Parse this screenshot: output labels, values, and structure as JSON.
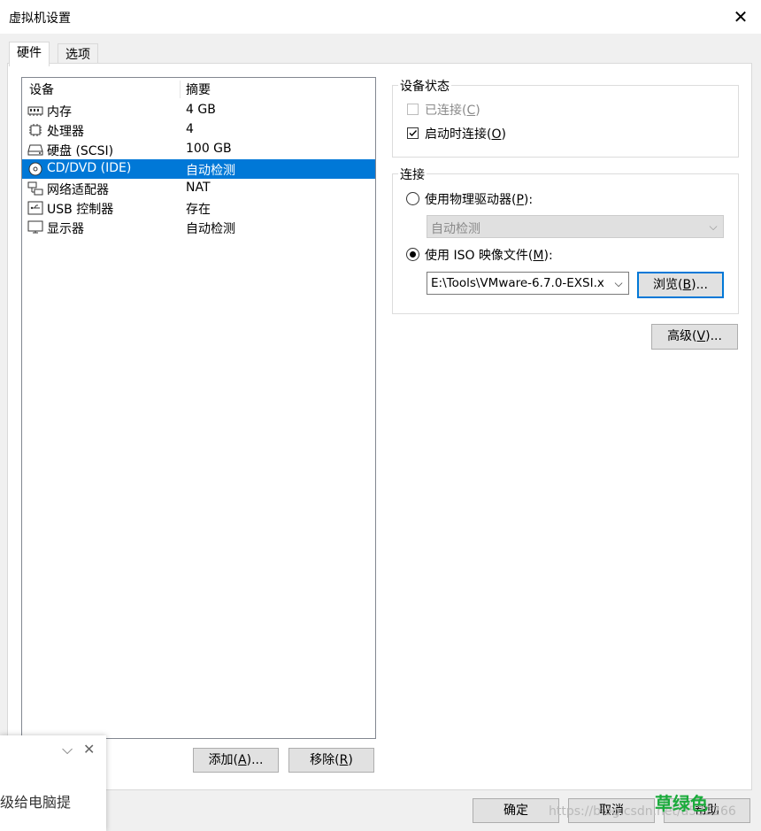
{
  "window": {
    "title": "虚拟机设置",
    "close_glyph": "✕"
  },
  "tabs": [
    {
      "label": "硬件"
    },
    {
      "label": "选项"
    }
  ],
  "device_list": {
    "col_device": "设备",
    "col_summary": "摘要",
    "rows": [
      {
        "name": "内存",
        "summary": "4 GB",
        "icon": "memory-icon"
      },
      {
        "name": "处理器",
        "summary": "4",
        "icon": "cpu-icon"
      },
      {
        "name": "硬盘 (SCSI)",
        "summary": "100 GB",
        "icon": "hard-disk-icon"
      },
      {
        "name": "CD/DVD (IDE)",
        "summary": "自动检测",
        "icon": "cd-dvd-icon",
        "selected": true
      },
      {
        "name": "网络适配器",
        "summary": "NAT",
        "icon": "network-adapter-icon"
      },
      {
        "name": "USB 控制器",
        "summary": "存在",
        "icon": "usb-icon"
      },
      {
        "name": "显示器",
        "summary": "自动检测",
        "icon": "display-icon"
      }
    ]
  },
  "list_buttons": {
    "add": {
      "pre": "添加(",
      "key": "A",
      "post": ")..."
    },
    "remove": {
      "pre": "移除(",
      "key": "R",
      "post": ")"
    }
  },
  "device_status": {
    "title": "设备状态",
    "connected": {
      "pre": "已连接(",
      "key": "C",
      "post": ")",
      "checked": false,
      "enabled": false
    },
    "connect_on_start": {
      "pre": "启动时连接(",
      "key": "O",
      "post": ")",
      "checked": true
    }
  },
  "connection": {
    "title": "连接",
    "physical": {
      "pre": "使用物理驱动器(",
      "key": "P",
      "post": "):",
      "selected": false
    },
    "physical_drive_value": "自动检测",
    "iso": {
      "pre": "使用 ISO 映像文件(",
      "key": "M",
      "post": "):",
      "selected": true
    },
    "iso_path": "E:\\Tools\\VMware-6.7.0-EXSI.x",
    "browse": {
      "pre": "浏览(",
      "key": "B",
      "post": ")..."
    }
  },
  "advanced": {
    "pre": "高级(",
    "key": "V",
    "post": ")..."
  },
  "footer": {
    "ok": "确定",
    "cancel": "取消",
    "help": "帮助"
  },
  "notification": {
    "message": "级给电脑提"
  },
  "watermark": {
    "brand": "草绿色",
    "url": "https://blog.csdn.net/a532266"
  },
  "colors": {
    "selection": "#0078d7",
    "button_face": "#e1e1e1",
    "dialog_bg": "#f0f0f0"
  }
}
